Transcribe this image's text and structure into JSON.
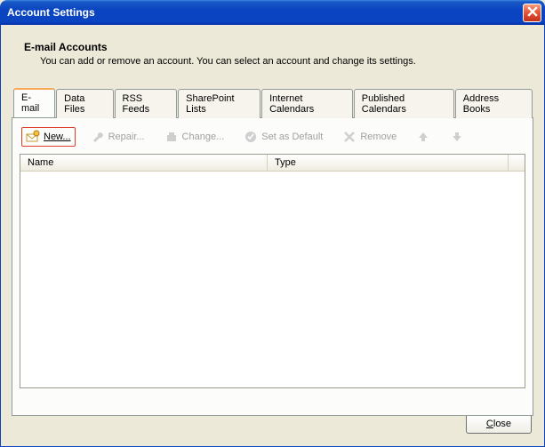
{
  "window": {
    "title": "Account Settings"
  },
  "heading": {
    "title": "E-mail Accounts",
    "description": "You can add or remove an account. You can select an account and change its settings."
  },
  "tabs": [
    {
      "label": "E-mail",
      "active": true
    },
    {
      "label": "Data Files",
      "active": false
    },
    {
      "label": "RSS Feeds",
      "active": false
    },
    {
      "label": "SharePoint Lists",
      "active": false
    },
    {
      "label": "Internet Calendars",
      "active": false
    },
    {
      "label": "Published Calendars",
      "active": false
    },
    {
      "label": "Address Books",
      "active": false
    }
  ],
  "toolbar": {
    "new_label": "New...",
    "repair_label": "Repair...",
    "change_label": "Change...",
    "default_label": "Set as Default",
    "remove_label": "Remove"
  },
  "columns": {
    "name": "Name",
    "type": "Type"
  },
  "accounts": [],
  "footer": {
    "close_label": "Close"
  },
  "colors": {
    "titlebar": "#0a44c0",
    "highlight": "#e03a2a",
    "tab_active_border": "#f7a856"
  }
}
